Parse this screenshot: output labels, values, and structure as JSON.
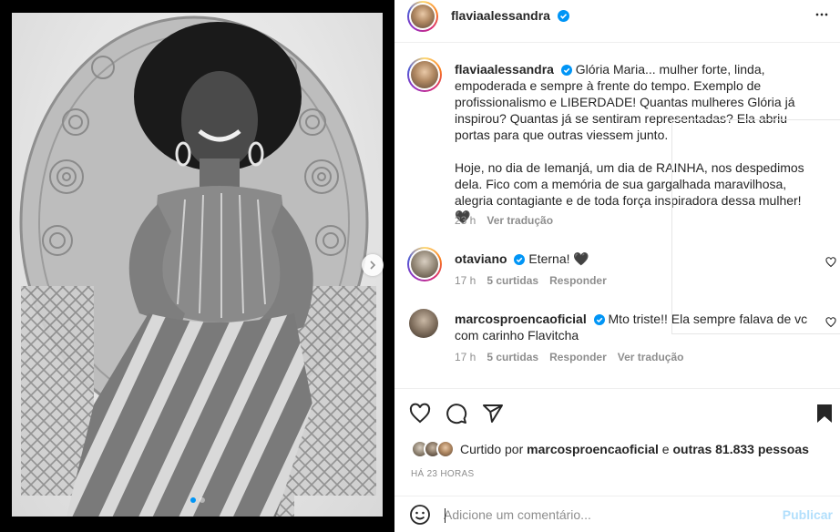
{
  "post": {
    "author": "flaviaalessandra",
    "caption": "Glória Maria... mulher forte, linda, empoderada e sempre à frente do tempo. Exemplo de profissionalismo e LIBERDADE! Quantas mulheres Glória já inspirou? Quantas já se sentiram representadas? Ela abriu portas para que outras viessem junto.",
    "caption2": "Hoje, no dia de Iemanjá, um dia de RAINHA, nos despedimos dela. Fico com a memória de sua gargalhada maravilhosa, alegria contagiante e de toda força inspiradora dessa mulher! 🖤",
    "time": "23 h",
    "translate": "Ver tradução"
  },
  "comments": [
    {
      "user": "otaviano",
      "text": "Eterna! 🖤",
      "time": "17 h",
      "likes": "5 curtidas",
      "reply": "Responder"
    },
    {
      "user": "marcosproencaoficial",
      "text": "Mto triste!! Ela sempre falava de vc com carinho Flavitcha",
      "time": "17 h",
      "likes": "5 curtidas",
      "reply": "Responder",
      "translate": "Ver tradução"
    }
  ],
  "likes": {
    "prefix": "Curtido por",
    "user": "marcosproencaoficial",
    "middle": "e",
    "others": "outras 81.833 pessoas"
  },
  "time_ago": "HÁ 23 HORAS",
  "add_comment": {
    "placeholder": "Adicione um comentário...",
    "post_label": "Publicar"
  },
  "icons": {
    "more": "more-horizontal-icon",
    "verified": "verified-badge-icon",
    "like": "heart-icon",
    "comment": "comment-icon",
    "share": "send-icon",
    "save": "bookmark-icon",
    "emoji": "emoji-icon",
    "next": "chevron-right-icon"
  },
  "colors": {
    "accent": "#0095f6",
    "post_disabled": "#b2dffc",
    "muted": "#8e8e8e",
    "text": "#262626"
  },
  "carousel": {
    "slides": 2,
    "active": 1
  }
}
